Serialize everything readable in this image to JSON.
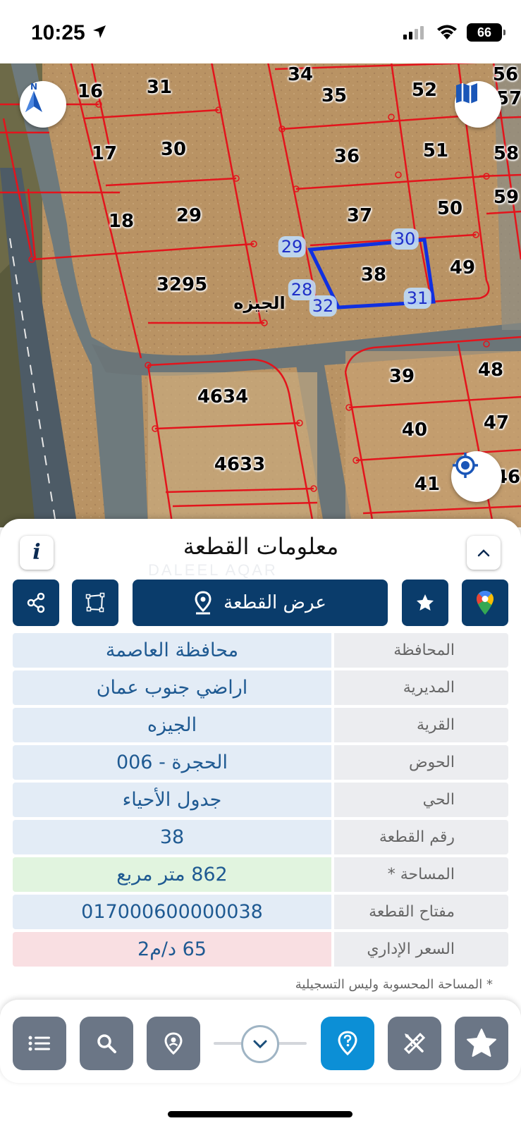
{
  "status_bar": {
    "time": "10:25",
    "battery": "66"
  },
  "map": {
    "parcels": [
      {
        "label": "16"
      },
      {
        "label": "31"
      },
      {
        "label": "34"
      },
      {
        "label": "35"
      },
      {
        "label": "52"
      },
      {
        "label": "56"
      },
      {
        "label": "57"
      },
      {
        "label": "17"
      },
      {
        "label": "30"
      },
      {
        "label": "36"
      },
      {
        "label": "51"
      },
      {
        "label": "58"
      },
      {
        "label": "59"
      },
      {
        "label": "18"
      },
      {
        "label": "29"
      },
      {
        "label": "37"
      },
      {
        "label": "50"
      },
      {
        "label": "38"
      },
      {
        "label": "49"
      },
      {
        "label": "3295"
      },
      {
        "label": "39"
      },
      {
        "label": "48"
      },
      {
        "label": "4634"
      },
      {
        "label": "40"
      },
      {
        "label": "47"
      },
      {
        "label": "4633"
      },
      {
        "label": "41"
      },
      {
        "label": "46"
      }
    ],
    "vertices": [
      {
        "label": "29"
      },
      {
        "label": "30"
      },
      {
        "label": "28"
      },
      {
        "label": "32"
      },
      {
        "label": "31"
      }
    ],
    "village_label": "الجيزه",
    "compass_letter": "N"
  },
  "sheet": {
    "title": "معلومات القطعة",
    "info_icon_text": "i",
    "watermark": "DALEEL AQAR",
    "show_parcel_label": "عرض القطعة",
    "rows": [
      {
        "label": "المحافظة",
        "value": "محافظة العاصمة"
      },
      {
        "label": "المديرية",
        "value": "اراضي جنوب عمان"
      },
      {
        "label": "القرية",
        "value": "الجيزه"
      },
      {
        "label": "الحوض",
        "value": "الحجرة - 006"
      },
      {
        "label": "الحي",
        "value": "جدول الأحياء"
      },
      {
        "label": "رقم القطعة",
        "value": "38"
      },
      {
        "label": "المساحة *",
        "value": "862  متر مربع"
      },
      {
        "label": "مفتاح القطعة",
        "value": "017000600000038"
      },
      {
        "label": "السعر الإداري",
        "value": "65 د/م2"
      }
    ],
    "footnote": "* المساحة المحسوبة وليس التسجيلية"
  },
  "colors": {
    "primary": "#0a3c6b",
    "value_blue": "#1f5a92",
    "parcel_line": "#e3141c",
    "selected_parcel": "#1030e0",
    "active_tool": "#0c8fd6",
    "area_bg": "#e1f4df",
    "price_bg": "#f9dfe2"
  },
  "icons": {
    "compass": "compass-north-icon",
    "map_layers": "map-icon",
    "locate": "locate-crosshair-icon",
    "share": "share-icon",
    "polygon": "polygon-icon",
    "location_pin": "location-pin-icon",
    "star": "star-icon",
    "google_maps": "google-maps-pin-icon",
    "list": "list-icon",
    "search": "search-icon",
    "place_pin": "place-pin-icon",
    "chevron_down": "chevron-down-icon",
    "help_pin": "help-pin-icon",
    "measure": "measure-tools-icon",
    "favorites": "star-icon"
  }
}
